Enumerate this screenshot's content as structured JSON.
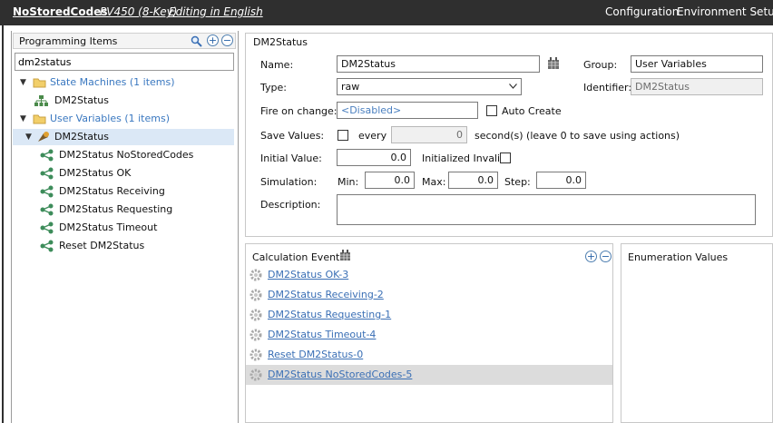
{
  "titlebar": {
    "app_name": "NoStoredCodes",
    "device": "PV450 (8-Key)",
    "language": "Editing in English",
    "menu": {
      "configuration": "Configuration",
      "environment": "Environment Setup"
    }
  },
  "left_panel": {
    "header": "Programming Items",
    "search_value": "dm2status",
    "tree": {
      "state_machines": {
        "label": "State Machines (1 items)",
        "items": [
          "DM2Status"
        ]
      },
      "user_variables": {
        "label": "User Variables (1 items)",
        "selected": "DM2Status",
        "children": [
          "DM2Status NoStoredCodes",
          "DM2Status OK",
          "DM2Status Receiving",
          "DM2Status Requesting",
          "DM2Status Timeout",
          "Reset DM2Status"
        ]
      }
    }
  },
  "main": {
    "section_title": "DM2Status",
    "name_label": "Name:",
    "name_value": "DM2Status",
    "group_label": "Group:",
    "group_value": "User Variables",
    "type_label": "Type:",
    "type_value": "raw",
    "identifier_label": "Identifier:",
    "identifier_value": "DM2Status",
    "fire_label": "Fire on change:",
    "fire_value": "<Disabled>",
    "auto_create_label": "Auto Create",
    "save_values_label": "Save Values:",
    "every_label": "every",
    "every_value": "0",
    "seconds_label": "second(s)  (leave 0 to save using actions)",
    "initial_label": "Initial Value:",
    "initial_value": "0.0",
    "init_invalid_label": "Initialized Invalid:",
    "simulation_label": "Simulation:",
    "min_label": "Min:",
    "min_value": "0.0",
    "max_label": "Max:",
    "max_value": "0.0",
    "step_label": "Step:",
    "step_value": "0.0",
    "description_label": "Description:",
    "description_value": ""
  },
  "calculation_events": {
    "title": "Calculation Events",
    "items": [
      "DM2Status OK-3",
      "DM2Status Receiving-2",
      "DM2Status Requesting-1",
      "DM2Status Timeout-4",
      "Reset DM2Status-0",
      "DM2Status NoStoredCodes-5"
    ],
    "selected_index": 5
  },
  "enumeration": {
    "title": "Enumeration Values"
  }
}
